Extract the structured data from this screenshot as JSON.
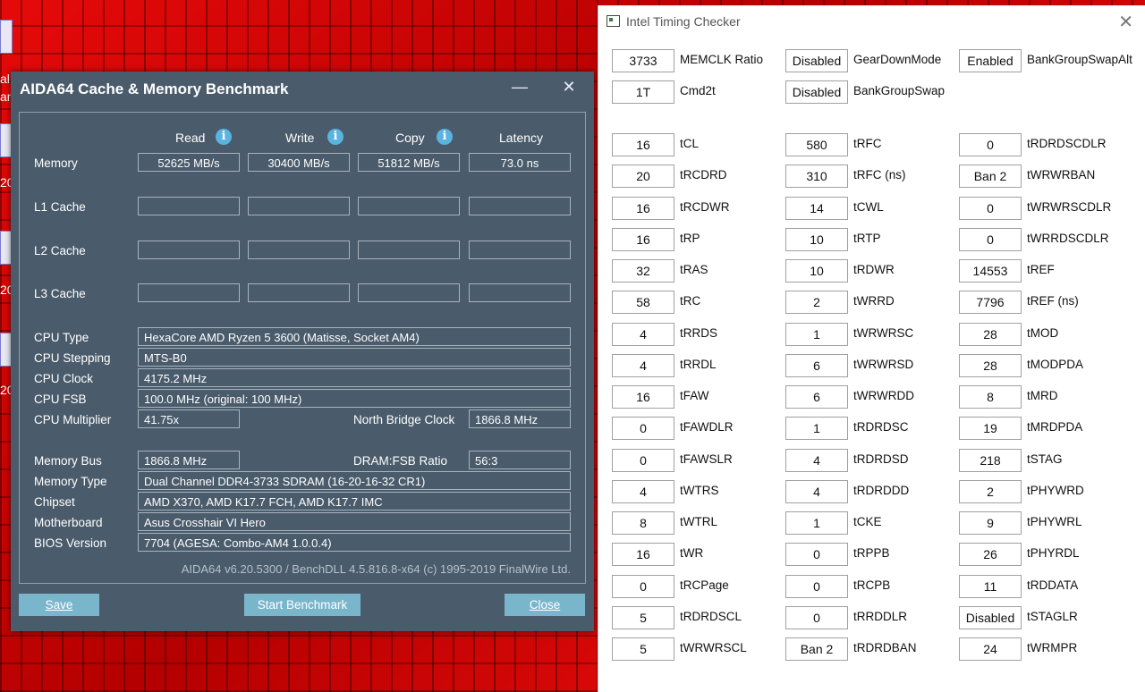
{
  "desktop": {
    "labels": [
      "al",
      "an",
      "20",
      "20",
      "20"
    ]
  },
  "aida": {
    "title": "AIDA64 Cache & Memory Benchmark",
    "minimize_glyph": "—",
    "close_glyph": "✕",
    "headers": {
      "read": "Read",
      "write": "Write",
      "copy": "Copy",
      "latency": "Latency"
    },
    "info_glyph": "i",
    "rows": [
      {
        "label": "Memory",
        "read": "52625 MB/s",
        "write": "30400 MB/s",
        "copy": "51812 MB/s",
        "latency": "73.0 ns"
      },
      {
        "label": "L1 Cache",
        "read": "",
        "write": "",
        "copy": "",
        "latency": ""
      },
      {
        "label": "L2 Cache",
        "read": "",
        "write": "",
        "copy": "",
        "latency": ""
      },
      {
        "label": "L3 Cache",
        "read": "",
        "write": "",
        "copy": "",
        "latency": ""
      }
    ],
    "cpu_type_label": "CPU Type",
    "cpu_type": "HexaCore AMD Ryzen 5 3600  (Matisse, Socket AM4)",
    "cpu_stepping_label": "CPU Stepping",
    "cpu_stepping": "MTS-B0",
    "cpu_clock_label": "CPU Clock",
    "cpu_clock": "4175.2 MHz",
    "cpu_fsb_label": "CPU FSB",
    "cpu_fsb": "100.0 MHz  (original: 100 MHz)",
    "cpu_multiplier_label": "CPU Multiplier",
    "cpu_multiplier": "41.75x",
    "nb_clock_label": "North Bridge Clock",
    "nb_clock": "1866.8 MHz",
    "memory_bus_label": "Memory Bus",
    "memory_bus": "1866.8 MHz",
    "dram_fsb_label": "DRAM:FSB Ratio",
    "dram_fsb": "56:3",
    "memory_type_label": "Memory Type",
    "memory_type": "Dual Channel DDR4-3733 SDRAM  (16-20-16-32 CR1)",
    "chipset_label": "Chipset",
    "chipset": "AMD X370, AMD K17.7 FCH, AMD K17.7 IMC",
    "motherboard_label": "Motherboard",
    "motherboard": "Asus Crosshair VI Hero",
    "bios_label": "BIOS Version",
    "bios": "7704  (AGESA: Combo-AM4 1.0.0.4)",
    "footer": "AIDA64 v6.20.5300 / BenchDLL 4.5.816.8-x64  (c) 1995-2019 FinalWire Ltd.",
    "save_label": "Save",
    "start_label": "Start Benchmark",
    "close_label": "Close"
  },
  "itc": {
    "title": "Intel Timing Checker",
    "close_glyph": "✕",
    "top": [
      [
        {
          "v": "3733",
          "n": "MEMCLK Ratio"
        },
        {
          "v": "Disabled",
          "n": "GearDownMode"
        },
        {
          "v": "Enabled",
          "n": "BankGroupSwapAlt"
        }
      ],
      [
        {
          "v": "1T",
          "n": "Cmd2t"
        },
        {
          "v": "Disabled",
          "n": "BankGroupSwap"
        },
        null
      ]
    ],
    "grid": [
      [
        {
          "v": "16",
          "n": "tCL"
        },
        {
          "v": "580",
          "n": "tRFC"
        },
        {
          "v": "0",
          "n": "tRDRDSCDLR"
        }
      ],
      [
        {
          "v": "20",
          "n": "tRCDRD"
        },
        {
          "v": "310",
          "n": "tRFC (ns)"
        },
        {
          "v": "Ban 2",
          "n": "tWRWRBAN"
        }
      ],
      [
        {
          "v": "16",
          "n": "tRCDWR"
        },
        {
          "v": "14",
          "n": "tCWL"
        },
        {
          "v": "0",
          "n": "tWRWRSCDLR"
        }
      ],
      [
        {
          "v": "16",
          "n": "tRP"
        },
        {
          "v": "10",
          "n": "tRTP"
        },
        {
          "v": "0",
          "n": "tWRRDSCDLR"
        }
      ],
      [
        {
          "v": "32",
          "n": "tRAS"
        },
        {
          "v": "10",
          "n": "tRDWR"
        },
        {
          "v": "14553",
          "n": "tREF"
        }
      ],
      [
        {
          "v": "58",
          "n": "tRC"
        },
        {
          "v": "2",
          "n": "tWRRD"
        },
        {
          "v": "7796",
          "n": "tREF (ns)"
        }
      ],
      [
        {
          "v": "4",
          "n": "tRRDS"
        },
        {
          "v": "1",
          "n": "tWRWRSC"
        },
        {
          "v": "28",
          "n": "tMOD"
        }
      ],
      [
        {
          "v": "4",
          "n": "tRRDL"
        },
        {
          "v": "6",
          "n": "tWRWRSD"
        },
        {
          "v": "28",
          "n": "tMODPDA"
        }
      ],
      [
        {
          "v": "16",
          "n": "tFAW"
        },
        {
          "v": "6",
          "n": "tWRWRDD"
        },
        {
          "v": "8",
          "n": "tMRD"
        }
      ],
      [
        {
          "v": "0",
          "n": "tFAWDLR"
        },
        {
          "v": "1",
          "n": "tRDRDSC"
        },
        {
          "v": "19",
          "n": "tMRDPDA"
        }
      ],
      [
        {
          "v": "0",
          "n": "tFAWSLR"
        },
        {
          "v": "4",
          "n": "tRDRDSD"
        },
        {
          "v": "218",
          "n": "tSTAG"
        }
      ],
      [
        {
          "v": "4",
          "n": "tWTRS"
        },
        {
          "v": "4",
          "n": "tRDRDDD"
        },
        {
          "v": "2",
          "n": "tPHYWRD"
        }
      ],
      [
        {
          "v": "8",
          "n": "tWTRL"
        },
        {
          "v": "1",
          "n": "tCKE"
        },
        {
          "v": "9",
          "n": "tPHYWRL"
        }
      ],
      [
        {
          "v": "16",
          "n": "tWR"
        },
        {
          "v": "0",
          "n": "tRPPB"
        },
        {
          "v": "26",
          "n": "tPHYRDL"
        }
      ],
      [
        {
          "v": "0",
          "n": "tRCPage"
        },
        {
          "v": "0",
          "n": "tRCPB"
        },
        {
          "v": "11",
          "n": "tRDDATA"
        }
      ],
      [
        {
          "v": "5",
          "n": "tRDRDSCL"
        },
        {
          "v": "0",
          "n": "tRRDDLR"
        },
        {
          "v": "Disabled",
          "n": "tSTAGLR"
        }
      ],
      [
        {
          "v": "5",
          "n": "tWRWRSCL"
        },
        {
          "v": "Ban 2",
          "n": "tRDRDBAN"
        },
        {
          "v": "24",
          "n": "tWRMPR"
        }
      ]
    ]
  }
}
